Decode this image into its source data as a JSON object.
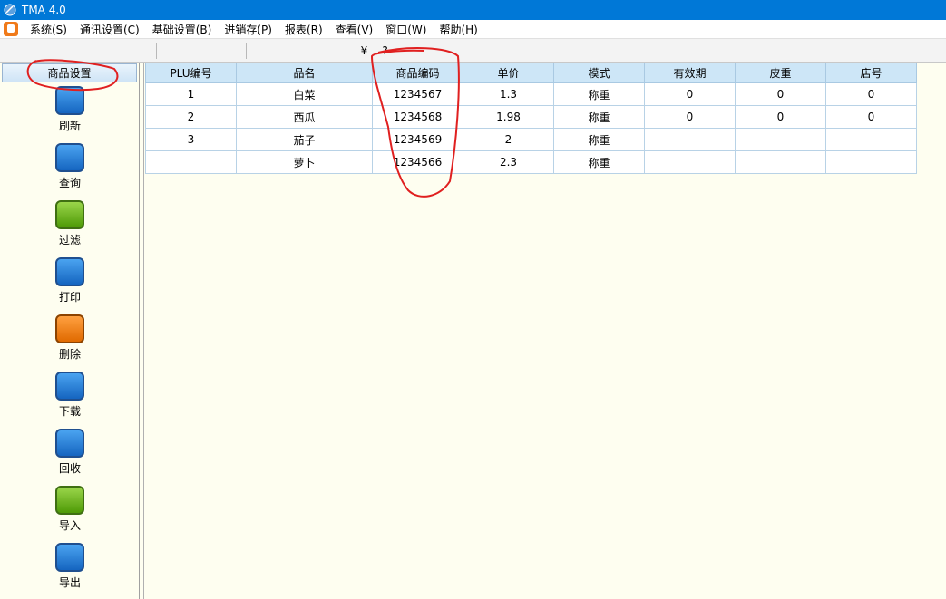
{
  "window": {
    "title": "TMA 4.0"
  },
  "menu": [
    "系统(S)",
    "通讯设置(C)",
    "基础设置(B)",
    "进销存(P)",
    "报表(R)",
    "查看(V)",
    "窗口(W)",
    "帮助(H)"
  ],
  "toolbar": {
    "groups": [
      [
        "star-icon",
        "tool-icon",
        "key-icon",
        "info-icon",
        "document-icon",
        "clock-icon",
        "settings-icon"
      ],
      [
        "add-icon",
        "play-icon",
        "refresh-icon",
        "database-icon"
      ],
      [
        "book-icon",
        "book-refresh-icon",
        "book-arrow-icon",
        "book-user-icon",
        "chart-icon",
        "currency-icon",
        "help-icon"
      ]
    ]
  },
  "sidebar": {
    "header": "商品设置",
    "buttons": [
      {
        "label": "刷新",
        "icon": "refresh-icon",
        "color": "#1565c0"
      },
      {
        "label": "查询",
        "icon": "search-icon",
        "color": "#1565c0"
      },
      {
        "label": "过滤",
        "icon": "globe-icon",
        "color": "#4e9a06"
      },
      {
        "label": "打印",
        "icon": "camera-icon",
        "color": "#1565c0"
      },
      {
        "label": "删除",
        "icon": "close-icon",
        "color": "#e06a00"
      },
      {
        "label": "下载",
        "icon": "arrow-down-icon",
        "color": "#1565c0"
      },
      {
        "label": "回收",
        "icon": "arrow-up-icon",
        "color": "#1565c0"
      },
      {
        "label": "导入",
        "icon": "double-chevron-down-icon",
        "color": "#4e9a06"
      },
      {
        "label": "导出",
        "icon": "double-chevron-up-icon",
        "color": "#1565c0"
      }
    ]
  },
  "grid": {
    "columns": [
      "PLU编号",
      "品名",
      "商品编码",
      "单价",
      "模式",
      "有效期",
      "皮重",
      "店号"
    ],
    "rows": [
      [
        "1",
        "白菜",
        "1234567",
        "1.3",
        "称重",
        "0",
        "0",
        "0"
      ],
      [
        "2",
        "西瓜",
        "1234568",
        "1.98",
        "称重",
        "0",
        "0",
        "0"
      ],
      [
        "3",
        "茄子",
        "1234569",
        "2",
        "称重",
        "",
        "",
        ""
      ],
      [
        "",
        "萝卜",
        "1234566",
        "2.3",
        "称重",
        "",
        "",
        ""
      ]
    ]
  },
  "colors": {
    "titlebar": "#0078d7",
    "annotation": "#e02020",
    "header": "#cde6f7",
    "background": "#fefef0"
  }
}
